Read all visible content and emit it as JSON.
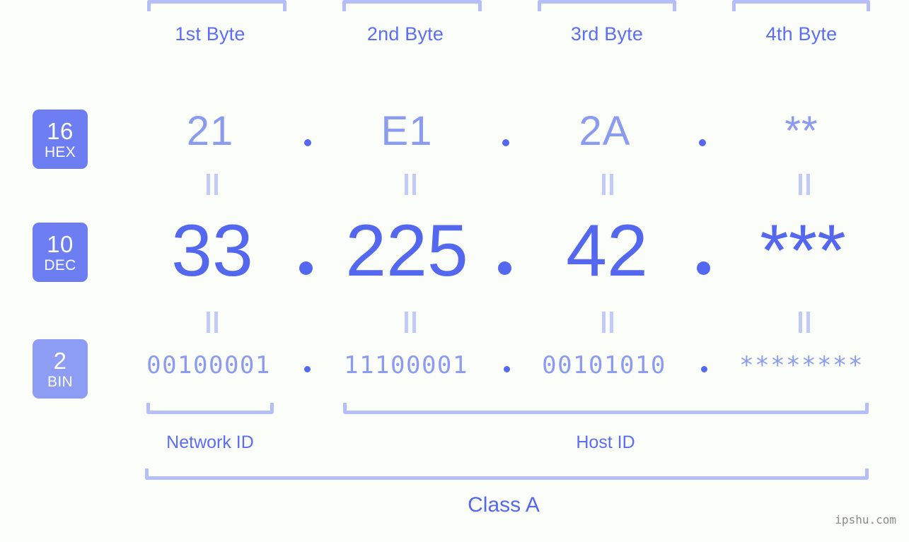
{
  "watermark": "ipshu.com",
  "byte_headers": [
    {
      "label": "1st Byte"
    },
    {
      "label": "2nd Byte"
    },
    {
      "label": "3rd Byte"
    },
    {
      "label": "4th Byte"
    }
  ],
  "rows": [
    {
      "base_number": "16",
      "base_name": "HEX",
      "values": [
        "21",
        "E1",
        "2A",
        "**"
      ]
    },
    {
      "base_number": "10",
      "base_name": "DEC",
      "values": [
        "33",
        "225",
        "42",
        "***"
      ]
    },
    {
      "base_number": "2",
      "base_name": "BIN",
      "values": [
        "00100001",
        "11100001",
        "00101010",
        "********"
      ]
    }
  ],
  "separators": {
    "dot": ".",
    "equals": "||"
  },
  "sections": [
    {
      "label": "Network ID"
    },
    {
      "label": "Host ID"
    }
  ],
  "class_label": "Class A",
  "colors": {
    "background": "#fbfdf8",
    "primary": "#5468ef",
    "secondary": "#8b9bf0",
    "bracket": "#b5bef8",
    "badge": "#6c7ef1",
    "badge_light": "#8d9df3",
    "watermark": "#8a8a8a"
  }
}
